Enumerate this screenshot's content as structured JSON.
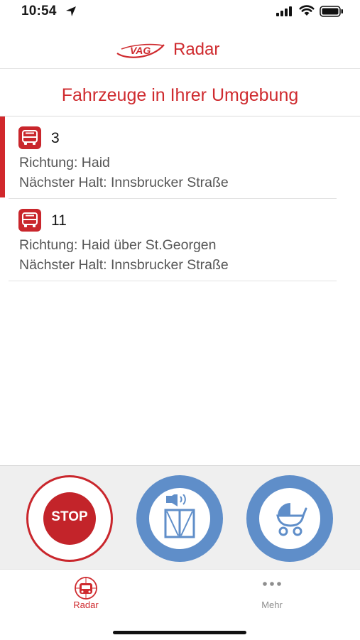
{
  "status_bar": {
    "time": "10:54"
  },
  "header": {
    "logo_text": "VAG",
    "title": "Radar"
  },
  "section_title": "Fahrzeuge in Ihrer Umgebung",
  "vehicles": [
    {
      "line": "3",
      "direction": "Richtung: Haid",
      "next_stop": "Nächster Halt: Innsbrucker Straße",
      "active": true
    },
    {
      "line": "11",
      "direction": "Richtung: Haid über St.Georgen",
      "next_stop": "Nächster Halt: Innsbrucker Straße",
      "active": false
    }
  ],
  "actions": {
    "stop_label": "STOP",
    "stop_icon": "stop-request-icon",
    "door_icon": "door-speaker-icon",
    "pram_icon": "pram-icon"
  },
  "tabs": [
    {
      "label": "Radar",
      "icon": "radar-bus-icon",
      "selected": true
    },
    {
      "label": "Mehr",
      "icon": "more-dots-icon",
      "selected": false
    }
  ],
  "colors": {
    "accent": "#cf2b2f",
    "action_blue": "#5f8ec9",
    "muted": "#8e8e8e"
  }
}
